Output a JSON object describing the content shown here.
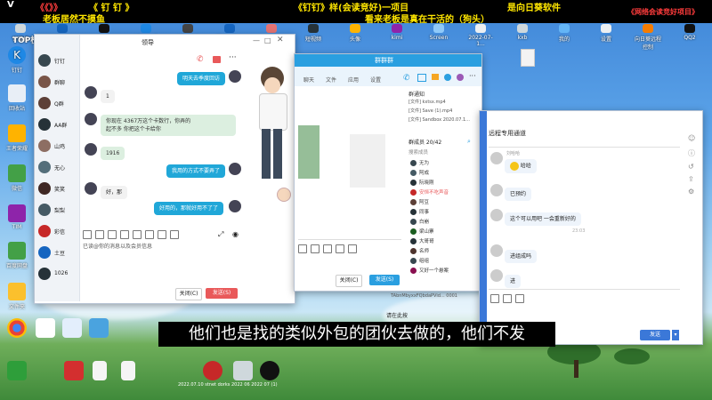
{
  "banner": {
    "corner": "V",
    "title_left": "《《》》",
    "title_app": "《 钉 钉 》",
    "title_center": "《钉钉》样(会读竞好)一项目",
    "title_right": "《网络会读竞好项目》",
    "caption_left": "老板居然不摸鱼",
    "caption_center": "看来老板是真在干活的（狗头）",
    "caption_right": "是向日葵软件"
  },
  "desktop": {
    "top_icons": [
      "计算机",
      "迅雷",
      "QQ",
      "Microsoft",
      "MS-DOS",
      "Photoshop",
      "截图",
      "短视频",
      "头像",
      "kimi",
      "Screen",
      "2022-07-1...",
      "kxb",
      "我的",
      "设置",
      "向日葵远程控制",
      "QQ2"
    ],
    "left_icons": [
      "回收站",
      "远程桌面",
      "控制面板",
      "王者荣耀",
      "微信",
      "QQ",
      "TIM",
      "百度网盘",
      "钉钉",
      "文件夹"
    ],
    "overlay_label": "TOP榜 | 工作"
  },
  "chat_window": {
    "title": "领导",
    "sidebar": [
      "钉钉",
      "群聊",
      "Q群",
      "AA群",
      "山鸡",
      "无心",
      "笑笑",
      "梨梨",
      "彩信",
      "土豆",
      "1026"
    ],
    "messages": [
      {
        "side": "right",
        "text": "明天去季度回访"
      },
      {
        "side": "left",
        "text": "1"
      },
      {
        "side": "left",
        "text": "你现在 4367万这个卡数行，你弄的\n起不多 你把这个卡给你"
      },
      {
        "side": "left",
        "text": "1916"
      },
      {
        "side": "right",
        "text": "我用的方式不要弄了"
      },
      {
        "side": "left",
        "text": "好，那"
      },
      {
        "side": "right",
        "text": "好用的，那就好用不了了"
      }
    ],
    "input_hint": "已读@你的消息以及会员信息",
    "close_button": "关闭(C)",
    "send_button": "发送(S)"
  },
  "group_window": {
    "title": "群群群",
    "tabs": [
      "聊天",
      "文件",
      "应用",
      "设置"
    ],
    "announcement_label": "群通知",
    "files": [
      "[文件] kxtsx.mp4",
      "[文件] Save (1).mp4",
      "[文件] Sandbox 2020.07.1..."
    ],
    "members_label": "群成员 20/42",
    "search_label": "搜索成员",
    "members": [
      "无为",
      "阿成",
      "阮晓刚",
      "安恒不吃声音",
      "阿豆",
      "同事",
      "白崩",
      "梁山寨",
      "大哥哥",
      "名师",
      "组组",
      "又好一个悬案"
    ],
    "close_button": "关闭(C)",
    "send_button": "发送(S)"
  },
  "dingtalk_window": {
    "title": "远程专用通道",
    "notes": [
      "刘哈哈",
      "已预约",
      "哈哈",
      "这个可以用吧 一会重新好的",
      "23:03",
      "进组成吗",
      "进"
    ],
    "time_label": "23:01",
    "file_item": "TAbnMbyxxFQbdaPVid...  0001",
    "input_label": "请在此按",
    "send_button": "发送"
  },
  "subtitle": "他们也是找的类似外包的团伙去做的，他们不发",
  "taskbar": {
    "icons": [
      "Chrome",
      "腾讯",
      "文件",
      "云盘",
      "红帽",
      "文档",
      "文档",
      "录屏",
      "工具",
      "QQ"
    ],
    "status_text": "2022.07.10 stnet dorks 2022 06 2022 07 (1)"
  },
  "colors": {
    "accent": "#20a7d8",
    "send_red": "#e9595a",
    "banner_red": "#ff3c3c",
    "banner_yellow": "#ffe600"
  }
}
